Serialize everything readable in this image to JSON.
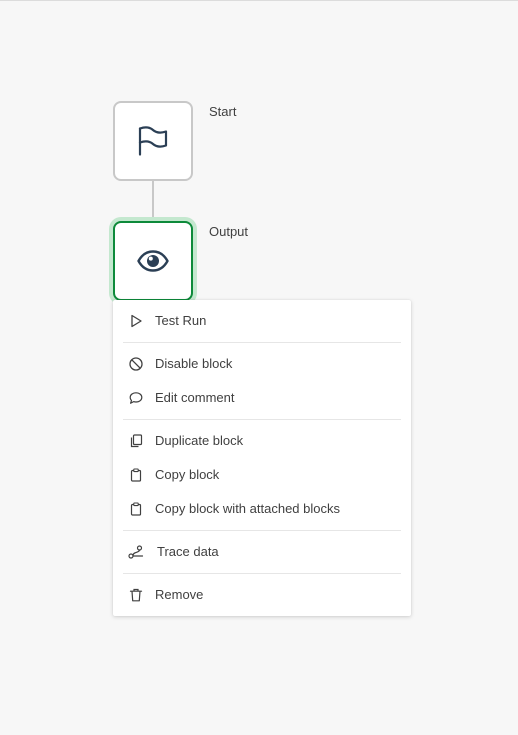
{
  "canvas": {
    "blocks": [
      {
        "label": "Start",
        "icon": "flag-icon",
        "selected": false
      },
      {
        "label": "Output",
        "icon": "eye-icon",
        "selected": true
      }
    ],
    "colors": {
      "selected_border": "#0d8a3a",
      "selected_glow": "#c4e8cf",
      "block_border": "#c8c8c8",
      "background": "#f7f7f7"
    }
  },
  "context_menu": {
    "items": [
      {
        "label": "Test Run",
        "icon": "play-icon"
      },
      {
        "label": "Disable block",
        "icon": "disable-icon"
      },
      {
        "label": "Edit comment",
        "icon": "comment-icon"
      },
      {
        "label": "Duplicate block",
        "icon": "duplicate-icon"
      },
      {
        "label": "Copy block",
        "icon": "clipboard-icon"
      },
      {
        "label": "Copy block with attached blocks",
        "icon": "clipboard-icon"
      },
      {
        "label": "Trace data",
        "icon": "trace-icon"
      },
      {
        "label": "Remove",
        "icon": "trash-icon"
      }
    ]
  }
}
